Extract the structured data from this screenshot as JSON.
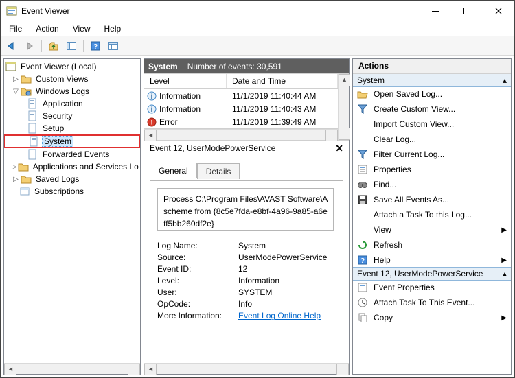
{
  "window": {
    "title": "Event Viewer"
  },
  "menu": {
    "file": "File",
    "action": "Action",
    "view": "View",
    "help": "Help"
  },
  "tree": {
    "root": "Event Viewer (Local)",
    "custom_views": "Custom Views",
    "windows_logs": "Windows Logs",
    "application": "Application",
    "security": "Security",
    "setup": "Setup",
    "system": "System",
    "forwarded": "Forwarded Events",
    "apps_services": "Applications and Services Lo",
    "saved_logs": "Saved Logs",
    "subscriptions": "Subscriptions"
  },
  "center": {
    "header_left": "System",
    "header_right": "Number of events: 30,591",
    "col_level": "Level",
    "col_datetime": "Date and Time",
    "rows": [
      {
        "level": "Information",
        "dt": "11/1/2019 11:40:44 AM",
        "kind": "info"
      },
      {
        "level": "Information",
        "dt": "11/1/2019 11:40:43 AM",
        "kind": "info"
      },
      {
        "level": "Error",
        "dt": "11/1/2019 11:39:49 AM",
        "kind": "error"
      }
    ],
    "detail_title": "Event 12, UserModePowerService",
    "tab_general": "General",
    "tab_details": "Details",
    "message": "Process C:\\Program Files\\AVAST Software\\A\nscheme from {8c5e7fda-e8bf-4a96-9a85-a6e\nff5bb260df2e}",
    "kv": {
      "log_name_k": "Log Name:",
      "log_name_v": "System",
      "source_k": "Source:",
      "source_v": "UserModePowerService",
      "event_id_k": "Event ID:",
      "event_id_v": "12",
      "level_k": "Level:",
      "level_v": "Information",
      "user_k": "User:",
      "user_v": "SYSTEM",
      "opcode_k": "OpCode:",
      "opcode_v": "Info",
      "more_k": "More Information:",
      "more_v": "Event Log Online Help"
    }
  },
  "actions": {
    "title": "Actions",
    "group1": "System",
    "items1": {
      "open_saved": "Open Saved Log...",
      "create_view": "Create Custom View...",
      "import_view": "Import Custom View...",
      "clear_log": "Clear Log...",
      "filter": "Filter Current Log...",
      "properties": "Properties",
      "find": "Find...",
      "save_all": "Save All Events As...",
      "attach_task": "Attach a Task To this Log...",
      "view": "View",
      "refresh": "Refresh",
      "help": "Help"
    },
    "group2": "Event 12, UserModePowerService",
    "items2": {
      "event_props": "Event Properties",
      "attach_event": "Attach Task To This Event...",
      "copy": "Copy"
    }
  }
}
